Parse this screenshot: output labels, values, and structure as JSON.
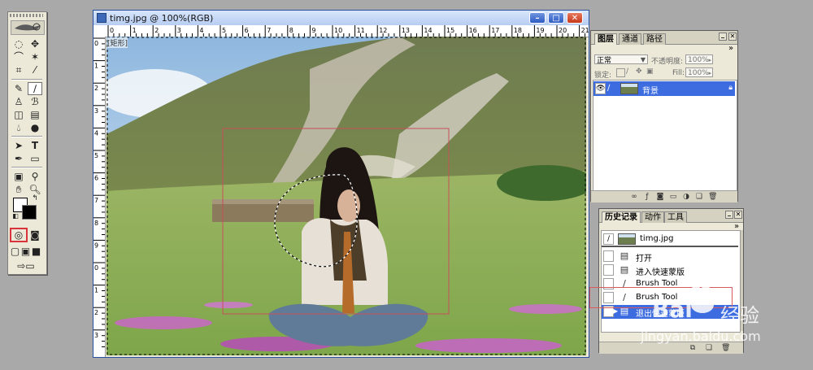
{
  "document": {
    "title": "timg.jpg @ 100%(RGB)",
    "controls": [
      "minimize",
      "maximize",
      "close"
    ],
    "ruler_top_labels": [
      "0",
      "1",
      "2",
      "3",
      "4",
      "5",
      "6",
      "7",
      "8",
      "9",
      "10",
      "11",
      "12",
      "13",
      "14",
      "15",
      "16",
      "17",
      "18",
      "19",
      "20",
      "21"
    ],
    "ruler_left_labels": [
      "0",
      "1",
      "2",
      "3",
      "4",
      "5",
      "6",
      "7",
      "8",
      "9",
      "0",
      "1",
      "2",
      "3"
    ],
    "canvas_tag": "[矩形]"
  },
  "layers_panel": {
    "tabs": [
      "图层",
      "通道",
      "路径"
    ],
    "blend_mode": "正常",
    "opacity_label": "不透明度:",
    "opacity_value": "100%",
    "lock_label": "锁定:",
    "fill_label": "Fill:",
    "fill_value": "100%",
    "layers": [
      {
        "name": "背景",
        "visible": true,
        "locked": true,
        "selected": true
      }
    ]
  },
  "history_panel": {
    "tabs": [
      "历史记录",
      "动作",
      "工具"
    ],
    "snapshot": "timg.jpg",
    "items": [
      {
        "label": "打开",
        "icon": "document-icon",
        "selected": false
      },
      {
        "label": "进入快速蒙版",
        "icon": "document-icon",
        "selected": false
      },
      {
        "label": "Brush Tool",
        "icon": "brush-icon",
        "selected": false
      },
      {
        "label": "Brush Tool",
        "icon": "brush-icon",
        "selected": false
      },
      {
        "label": "退出快速蒙版",
        "icon": "document-icon",
        "selected": true
      }
    ]
  },
  "watermark": {
    "brand": "Bai",
    "brand_suffix": "经验",
    "url": "jingyan.baidu.com"
  },
  "colors": {
    "selection_blue": "#3c6ce0",
    "title_gradient_top": "#d9e6fb",
    "highlight_red": "#d9343c",
    "workspace": "#a9a9a9"
  }
}
